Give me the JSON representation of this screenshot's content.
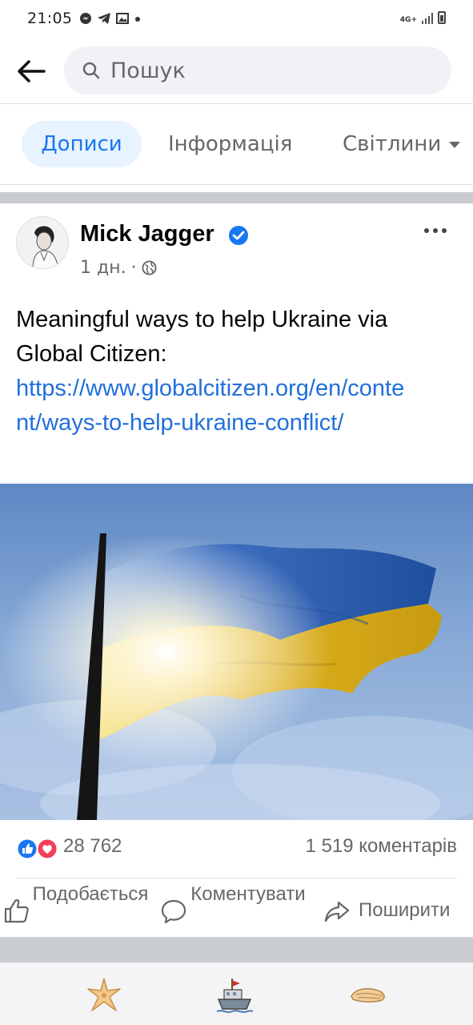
{
  "status_bar": {
    "time": "21:05",
    "left_icons": [
      "messenger-icon",
      "telegram-icon",
      "gallery-icon",
      "dot-icon"
    ],
    "network": "4G+",
    "right_icons": [
      "signal-icon",
      "battery-icon"
    ]
  },
  "header": {
    "back_icon": "arrow-left-icon",
    "search_icon": "search-icon",
    "search_placeholder": "Пошук"
  },
  "tabs": [
    {
      "label": "Дописи",
      "active": true
    },
    {
      "label": "Інформація",
      "active": false
    },
    {
      "label": "Світлини",
      "active": false,
      "has_dropdown": true
    }
  ],
  "post": {
    "author": "Mick Jagger",
    "verified": true,
    "time": "1 дн.",
    "separator": "·",
    "privacy_icon": "globe-icon",
    "text": "Meaningful ways to help Ukraine via Global Citizen:",
    "link": "https://www.globalcitizen.org/en/content/ways-to-help-ukraine-conflict/",
    "image_alt": "Ukrainian flag waving against the sky",
    "reactions": {
      "icons": [
        "like-icon",
        "love-icon"
      ],
      "count": "28 762",
      "comments": "1 519 коментарів"
    },
    "actions": [
      {
        "label": "Подобається",
        "icon": "thumbs-up-icon"
      },
      {
        "label": "Коментувати",
        "icon": "comment-icon"
      },
      {
        "label": "Поширити",
        "icon": "share-icon"
      }
    ]
  },
  "bottom_nav": {
    "items": [
      "starfish-icon",
      "boat-icon",
      "shell-icon"
    ]
  },
  "colors": {
    "accent": "#1877f2",
    "link": "#216fdb",
    "secondary_text": "#65676b",
    "flag_blue": "#2f63b5",
    "flag_yellow": "#e6b820"
  }
}
